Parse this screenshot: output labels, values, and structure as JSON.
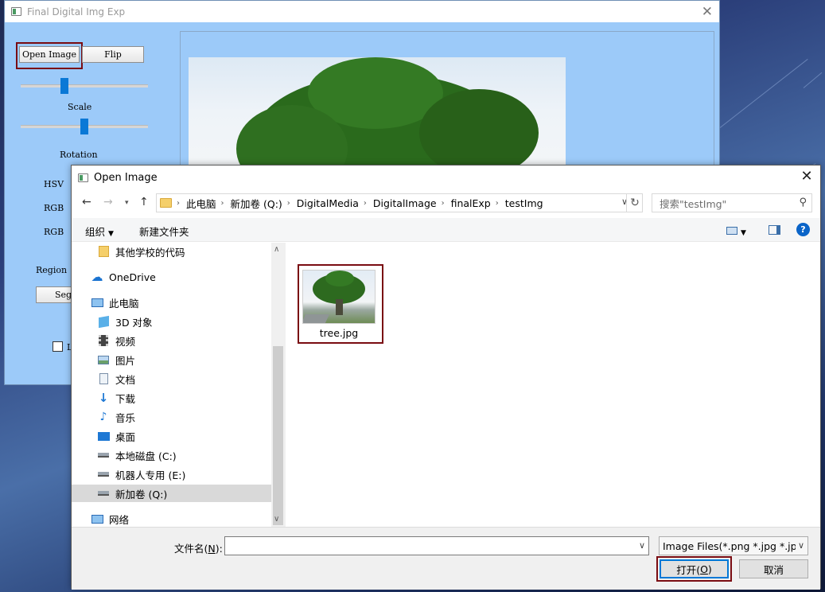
{
  "app": {
    "title": "Final Digital Img Exp",
    "open_image_label": "Open Image",
    "flip_label": "Flip",
    "scale_label": "Scale",
    "rotation_label": "Rotation",
    "hsv_label": "HSV",
    "rgb_label_1": "RGB",
    "rgb_label_2": "RGB",
    "region_label": "Region",
    "segment_partial": "Seg",
    "checkbox_partial": "L"
  },
  "dialog": {
    "title": "Open Image",
    "breadcrumb": [
      "此电脑",
      "新加卷 (Q:)",
      "DigitalMedia",
      "DigitalImage",
      "finalExp",
      "testImg"
    ],
    "search_placeholder": "搜索\"testImg\"",
    "organize_label": "组织",
    "new_folder_label": "新建文件夹",
    "nav_tree": [
      {
        "label": "其他学校的代码",
        "icon": "folder-icon"
      },
      {
        "label": "OneDrive",
        "icon": "cloud-icon"
      },
      {
        "label": "此电脑",
        "icon": "computer-icon"
      },
      {
        "label": "3D 对象",
        "icon": "cube-icon"
      },
      {
        "label": "视频",
        "icon": "video-icon"
      },
      {
        "label": "图片",
        "icon": "picture-icon"
      },
      {
        "label": "文档",
        "icon": "document-icon"
      },
      {
        "label": "下载",
        "icon": "download-icon"
      },
      {
        "label": "音乐",
        "icon": "music-icon"
      },
      {
        "label": "桌面",
        "icon": "desktop-icon"
      },
      {
        "label": "本地磁盘 (C:)",
        "icon": "drive-icon"
      },
      {
        "label": "机器人专用 (E:)",
        "icon": "drive-icon"
      },
      {
        "label": "新加卷 (Q:)",
        "icon": "drive-icon",
        "selected": true
      },
      {
        "label": "网络",
        "icon": "network-icon"
      }
    ],
    "files": [
      {
        "name": "tree.jpg"
      }
    ],
    "filename_label": "文件名(N):",
    "filename_label_main": "文件名(",
    "filename_label_key": "N",
    "filename_label_tail": "):",
    "filename_value": "",
    "filetype_value": "Image Files(*.png *.jpg *.jpe",
    "open_button_main": "打开(",
    "open_button_key": "O",
    "open_button_tail": ")",
    "cancel_button": "取消"
  },
  "colors": {
    "app_background": "#9ccaf9",
    "highlight_box": "#7a0c12",
    "slider_thumb": "#0a78d6",
    "help_icon": "#0a64c8"
  }
}
